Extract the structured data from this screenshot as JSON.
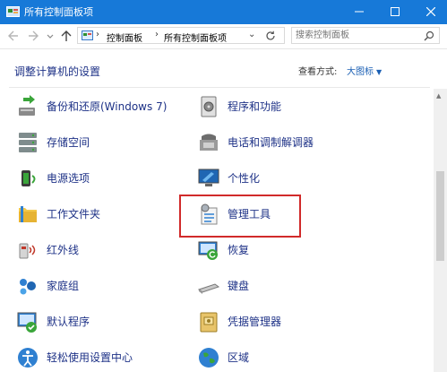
{
  "window": {
    "title": "所有控制面板项"
  },
  "address": {
    "crumbs": [
      "控制面板",
      "所有控制面板项"
    ],
    "separator": "›"
  },
  "search": {
    "placeholder": "搜索控制面板"
  },
  "header": {
    "title": "调整计算机的设置",
    "view_by_label": "查看方式:",
    "view_by_value": "大图标"
  },
  "items": [
    {
      "label": "备份和还原(Windows 7)",
      "icon": "backup-restore-icon"
    },
    {
      "label": "程序和功能",
      "icon": "programs-features-icon"
    },
    {
      "label": "存储空间",
      "icon": "storage-spaces-icon"
    },
    {
      "label": "电话和调制解调器",
      "icon": "phone-modem-icon"
    },
    {
      "label": "电源选项",
      "icon": "power-options-icon"
    },
    {
      "label": "个性化",
      "icon": "personalization-icon"
    },
    {
      "label": "工作文件夹",
      "icon": "work-folders-icon"
    },
    {
      "label": "管理工具",
      "icon": "admin-tools-icon"
    },
    {
      "label": "红外线",
      "icon": "infrared-icon"
    },
    {
      "label": "恢复",
      "icon": "recovery-icon"
    },
    {
      "label": "家庭组",
      "icon": "homegroup-icon"
    },
    {
      "label": "键盘",
      "icon": "keyboard-icon"
    },
    {
      "label": "默认程序",
      "icon": "default-programs-icon"
    },
    {
      "label": "凭据管理器",
      "icon": "credential-manager-icon"
    },
    {
      "label": "轻松使用设置中心",
      "icon": "ease-of-access-icon"
    },
    {
      "label": "区域",
      "icon": "region-icon"
    }
  ],
  "colors": {
    "titlebar": "#1779d8",
    "link": "#1e3287",
    "highlight_border": "#d12a2a"
  }
}
